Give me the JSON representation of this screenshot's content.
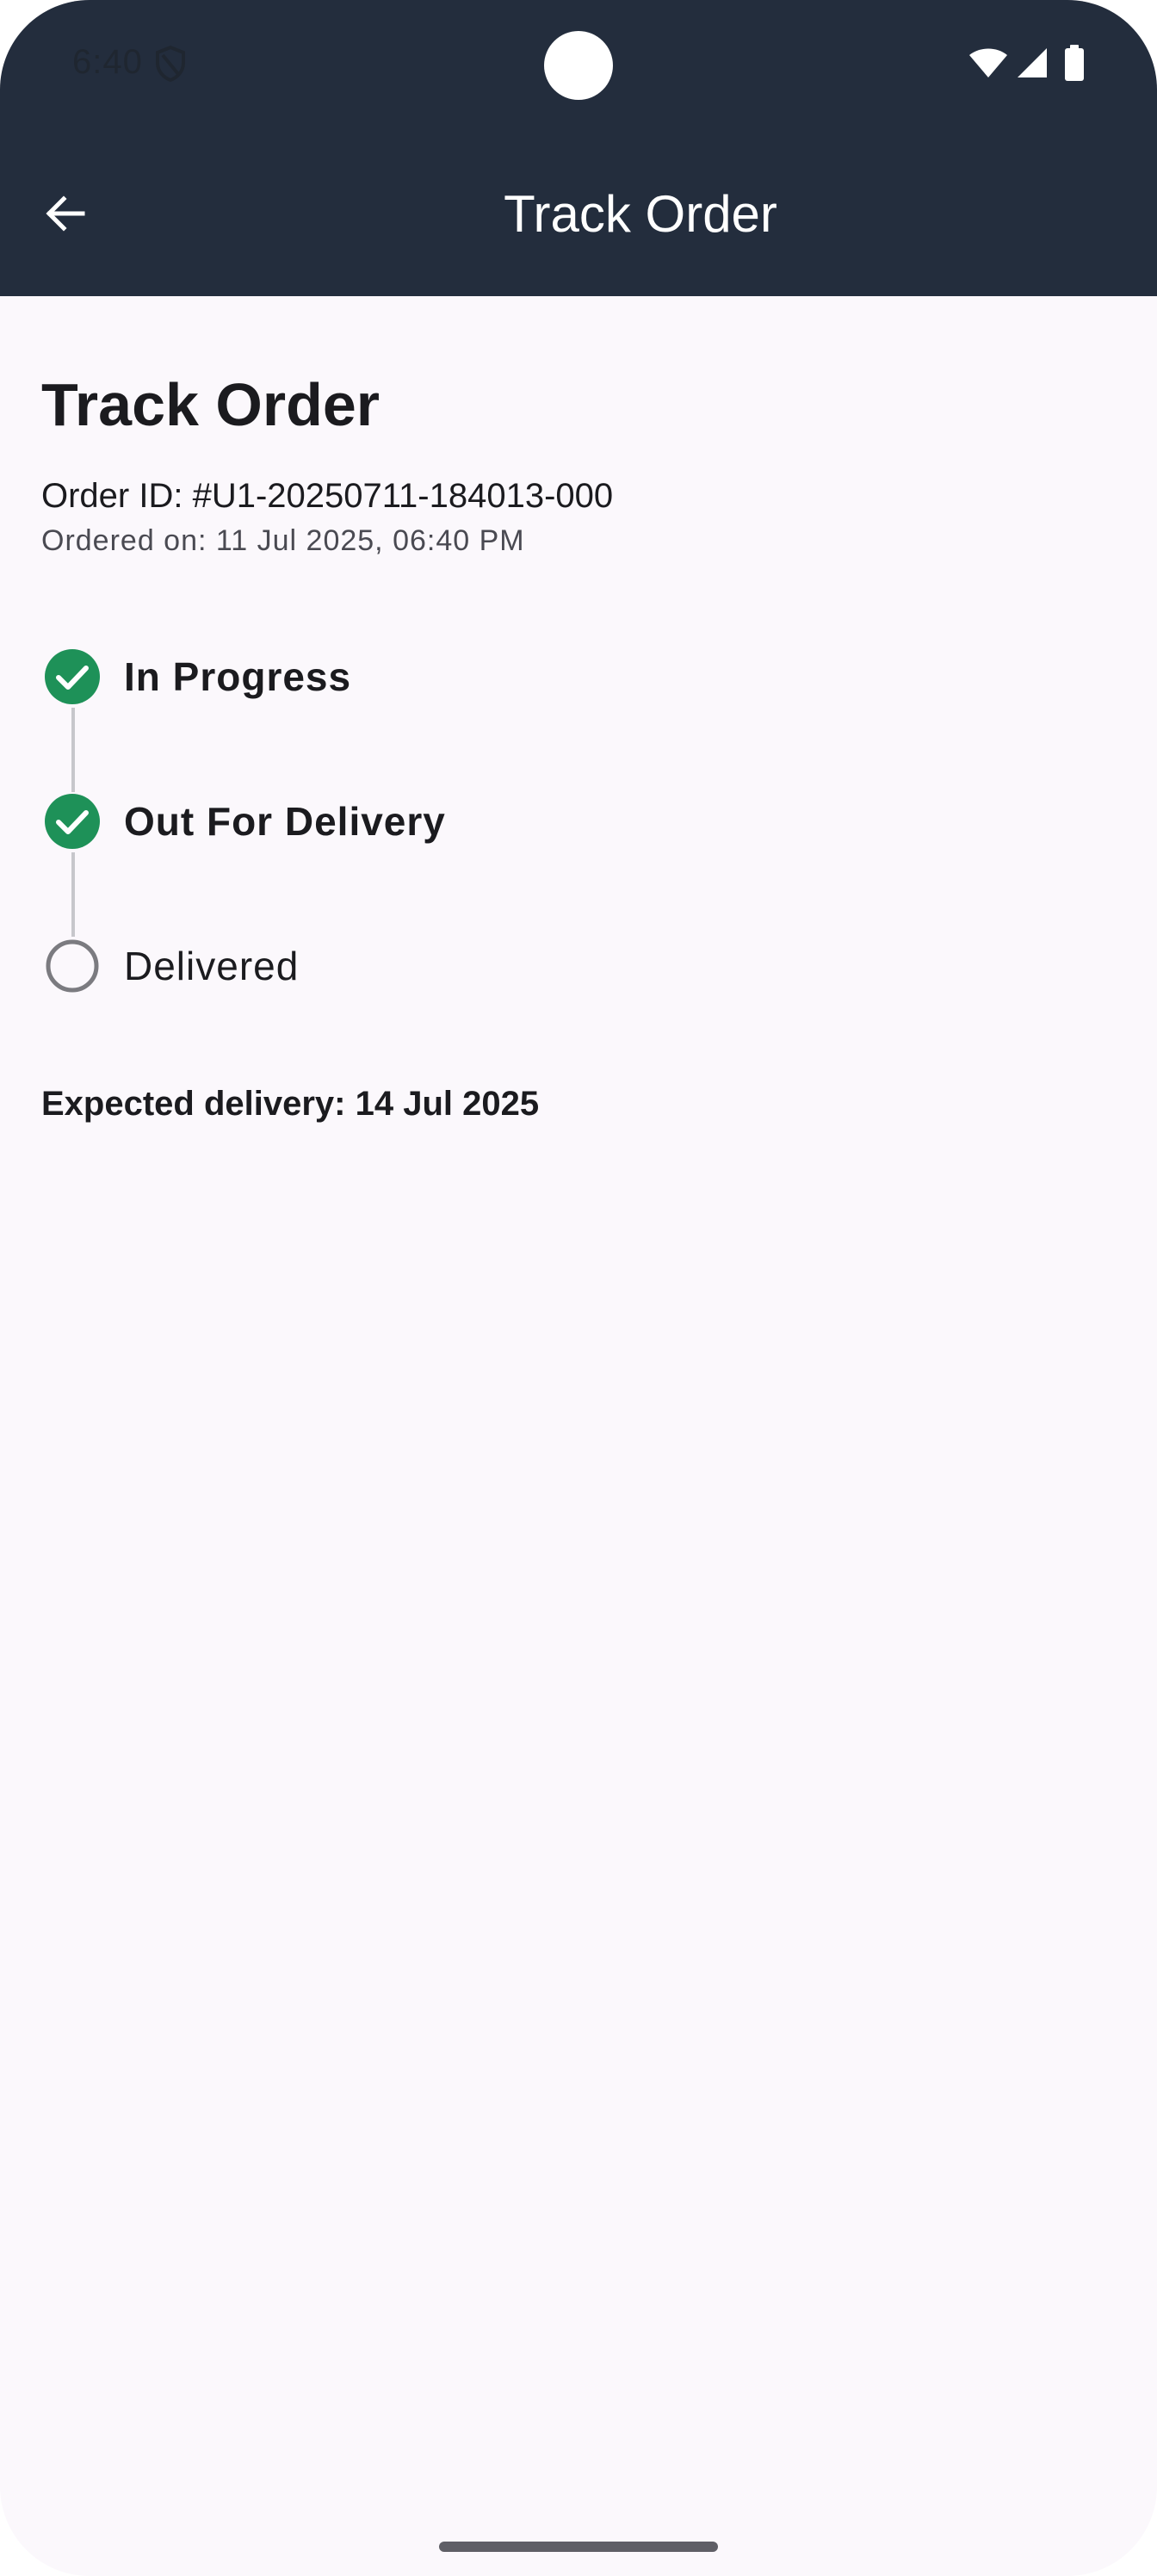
{
  "status_bar": {
    "time": "6:40",
    "icons": [
      "shield-icon",
      "wifi-icon",
      "signal-icon",
      "battery-icon"
    ]
  },
  "app_bar": {
    "title": "Track Order",
    "back_icon": "arrow-back-icon"
  },
  "order": {
    "heading": "Track Order",
    "order_id": "Order ID: #U1-20250711-184013-000",
    "ordered_on": "Ordered on: 11 Jul 2025, 06:40 PM",
    "expected_delivery": "Expected delivery: 14 Jul 2025"
  },
  "timeline": {
    "steps": [
      {
        "label": "In Progress",
        "status": "completed",
        "icon": "check-circle-icon"
      },
      {
        "label": "Out For Delivery",
        "status": "completed",
        "icon": "check-circle-icon"
      },
      {
        "label": "Delivered",
        "status": "pending",
        "icon": "empty-circle-icon"
      }
    ]
  },
  "colors": {
    "app_bar": "#232d3d",
    "background": "#fbf8fc",
    "completed": "#1e9158",
    "pending": "#7b7b80",
    "connector": "#c7c7cc",
    "text": "#1b1b1f"
  }
}
